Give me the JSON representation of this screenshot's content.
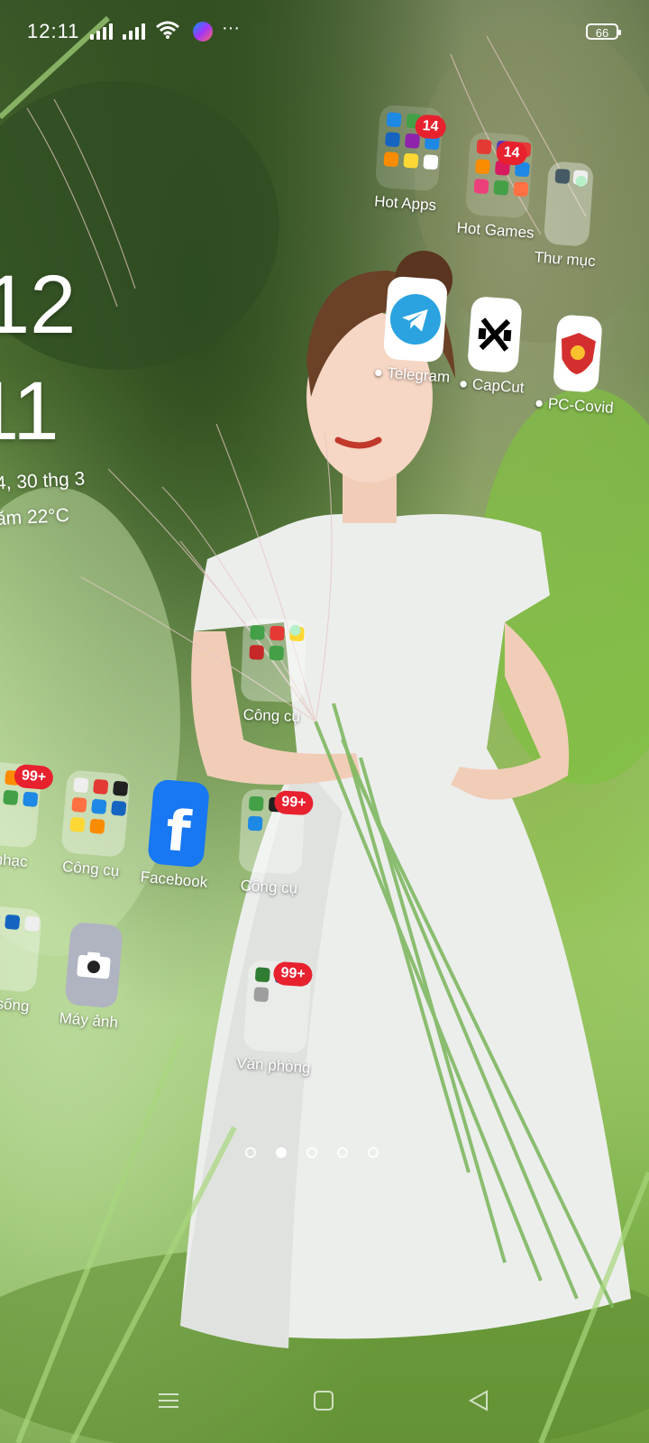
{
  "status_bar": {
    "time": "12:11",
    "battery": "66"
  },
  "clock_widget": {
    "hour": "12",
    "minute": "11",
    "date": "4, 30 thg 3",
    "weather": "ăm 22°C"
  },
  "folders": {
    "hot_apps": {
      "label": "Hot Apps",
      "badge": "14"
    },
    "hot_games": {
      "label": "Hot Games",
      "badge": "14"
    },
    "thu_muc": {
      "label": "Thư mục"
    },
    "cong_cu_1": {
      "label": "Công cụ"
    },
    "cong_cu_2": {
      "label": "Công cụ",
      "badge": "99+"
    },
    "van_phong": {
      "label": "Văn phòng",
      "badge": "99+"
    },
    "am_nhac": {
      "label": "m nhạc",
      "badge": "99+"
    },
    "cong_cu_left": {
      "label": "Công cụ"
    },
    "cuoc_song": {
      "label": "ộc sống"
    }
  },
  "apps": {
    "telegram": {
      "label": "Telegram"
    },
    "capcut": {
      "label": "CapCut"
    },
    "pc_covid": {
      "label": "PC-Covid"
    },
    "facebook": {
      "label": "Facebook"
    },
    "camera": {
      "label": "Máy ảnh"
    }
  },
  "colors": {
    "badge": "#e8212f",
    "telegram": "#2aa3e0",
    "facebook": "#1877f2"
  },
  "page_indicator": {
    "count": 5,
    "active_index": 1
  }
}
